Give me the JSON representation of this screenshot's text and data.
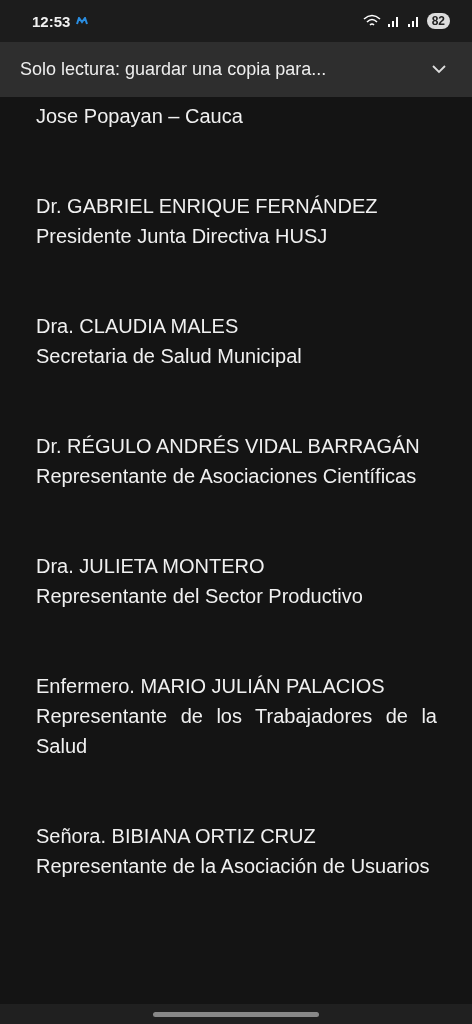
{
  "status_bar": {
    "time": "12:53",
    "battery": "82"
  },
  "banner": {
    "text": "Solo lectura: guardar una copia para..."
  },
  "entries": [
    {
      "lines": [
        "Jose Popayan – Cauca"
      ]
    },
    {
      "lines": [
        "Dr. GABRIEL ENRIQUE FERNÁNDEZ",
        "Presidente Junta Directiva HUSJ"
      ]
    },
    {
      "lines": [
        "Dra. CLAUDIA MALES",
        "Secretaria de Salud Municipal"
      ]
    },
    {
      "lines": [
        "Dr. RÉGULO ANDRÉS VIDAL BARRAGÁN",
        "Representante de Asociaciones Científicas"
      ]
    },
    {
      "lines": [
        "Dra. JULIETA MONTERO",
        "Representante del Sector Productivo"
      ]
    },
    {
      "lines": [
        "Enfermero. MARIO JULIÁN PALACIOS",
        "Representante de los Trabajadores de la Salud"
      ]
    },
    {
      "lines": [
        "Señora. BIBIANA ORTIZ CRUZ",
        "Representante de la Asociación de Usuarios"
      ]
    }
  ]
}
